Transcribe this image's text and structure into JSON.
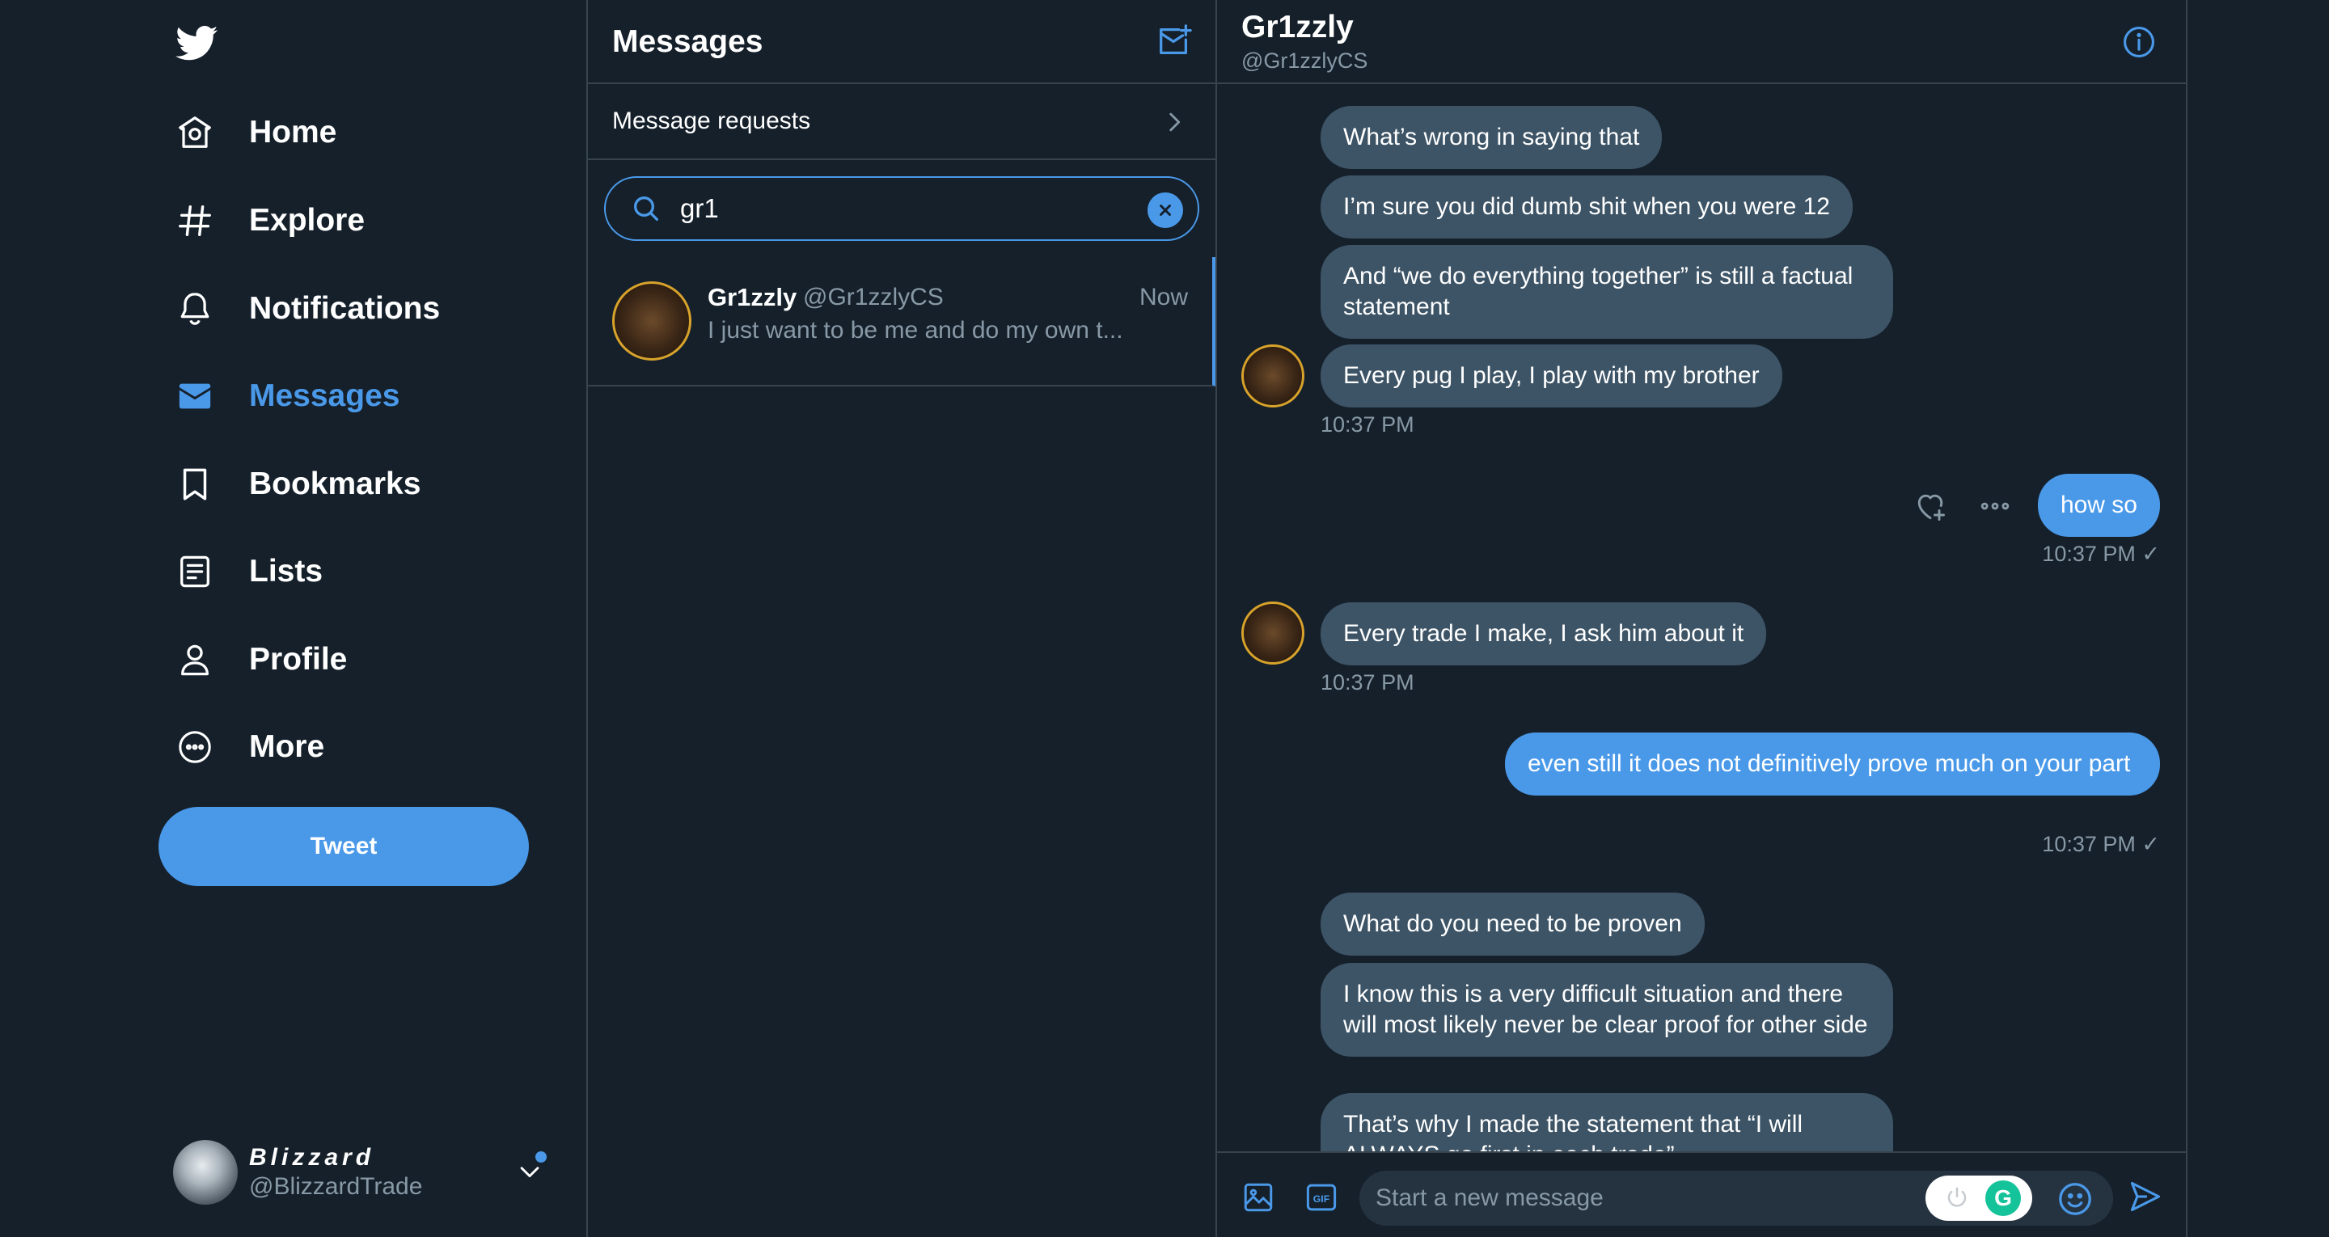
{
  "nav": {
    "logo_icon": "twitter-bird-icon",
    "items": [
      {
        "label": "Home",
        "icon": "home-icon"
      },
      {
        "label": "Explore",
        "icon": "hashtag-icon"
      },
      {
        "label": "Notifications",
        "icon": "bell-icon"
      },
      {
        "label": "Messages",
        "icon": "envelope-icon"
      },
      {
        "label": "Bookmarks",
        "icon": "bookmark-icon"
      },
      {
        "label": "Lists",
        "icon": "list-icon"
      },
      {
        "label": "Profile",
        "icon": "person-icon"
      },
      {
        "label": "More",
        "icon": "more-circle-icon"
      }
    ],
    "active": "Messages",
    "tweet_label": "Tweet",
    "account": {
      "name": "Blizzard",
      "handle": "@BlizzardTrade"
    }
  },
  "list": {
    "title": "Messages",
    "requests_label": "Message requests",
    "search": {
      "value": "gr1"
    },
    "conversations": [
      {
        "name": "Gr1zzly",
        "handle": "@Gr1zzlyCS",
        "time": "Now",
        "preview": "I just want to be me and do my own t..."
      }
    ]
  },
  "chat": {
    "name": "Gr1zzly",
    "handle": "@Gr1zzlyCS",
    "messages": [
      {
        "dir": "in",
        "text": "What’s wrong in saying that"
      },
      {
        "dir": "in",
        "text": "I’m sure you did dumb shit when you were 12"
      },
      {
        "dir": "in",
        "text": "And “we do everything together” is still a factual statement"
      },
      {
        "dir": "in",
        "text": "Every pug I play, I play with my brother"
      },
      {
        "dir": "in-time",
        "text": "10:37 PM"
      },
      {
        "dir": "out",
        "text": "how so"
      },
      {
        "dir": "out-time",
        "text": "10:37 PM ✓"
      },
      {
        "dir": "in",
        "text": "Every trade I make, I ask him about it"
      },
      {
        "dir": "in-time",
        "text": "10:37 PM"
      },
      {
        "dir": "out",
        "text": "even still it does not definitively prove much on your part"
      },
      {
        "dir": "out-time",
        "text": "10:37 PM ✓"
      },
      {
        "dir": "in",
        "text": "What do you need to be proven"
      },
      {
        "dir": "in",
        "text": "I know this is a very difficult situation and there will most likely never be clear proof for other side"
      },
      {
        "dir": "in",
        "text": "That’s why I made the statement that “I will ALWAYS go first in each trade”"
      }
    ],
    "composer_placeholder": "Start a new message",
    "grammarly_label": "G"
  },
  "colors": {
    "background": "#15202b",
    "accent": "#4a99e9",
    "bubble_in": "#3d5466",
    "border": "#38444d",
    "muted_text": "#8899a6"
  }
}
